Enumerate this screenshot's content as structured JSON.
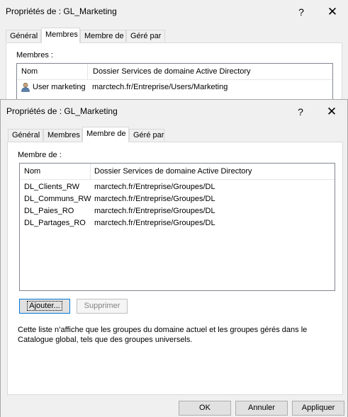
{
  "back_dialog": {
    "title": "Propriétés de : GL_Marketing",
    "help_glyph": "?",
    "close_glyph": "✕",
    "tabs": [
      "Général",
      "Membres",
      "Membre de",
      "Géré par"
    ],
    "active_tab": "Membres",
    "section_label": "Membres :",
    "columns": [
      "Nom",
      "Dossier Services de domaine Active Directory"
    ],
    "rows": [
      {
        "name": "User marketing",
        "folder": "marctech.fr/Entreprise/Users/Marketing",
        "icon": "user-icon"
      }
    ]
  },
  "front_dialog": {
    "title": "Propriétés de : GL_Marketing",
    "help_glyph": "?",
    "close_glyph": "✕",
    "tabs": [
      "Général",
      "Membres",
      "Membre de",
      "Géré par"
    ],
    "active_tab": "Membre de",
    "section_label": "Membre de :",
    "columns": [
      "Nom",
      "Dossier Services de domaine Active Directory"
    ],
    "rows": [
      {
        "name": "DL_Clients_RW",
        "folder": "marctech.fr/Entreprise/Groupes/DL"
      },
      {
        "name": "DL_Communs_RW",
        "folder": "marctech.fr/Entreprise/Groupes/DL"
      },
      {
        "name": "DL_Paies_RO",
        "folder": "marctech.fr/Entreprise/Groupes/DL"
      },
      {
        "name": "DL_Partages_RO",
        "folder": "marctech.fr/Entreprise/Groupes/DL"
      }
    ],
    "add_button": "Ajouter...",
    "remove_button": "Supprimer",
    "note": "Cette liste n’affiche que les groupes du domaine actuel et les groupes gérés dans le Catalogue global, tels que des groupes universels.",
    "ok_button": "OK",
    "cancel_button": "Annuler",
    "apply_button": "Appliquer"
  },
  "colors": {
    "window_bg": "#f0f0f0",
    "focus_border": "#0078d7",
    "list_border": "#828790"
  }
}
